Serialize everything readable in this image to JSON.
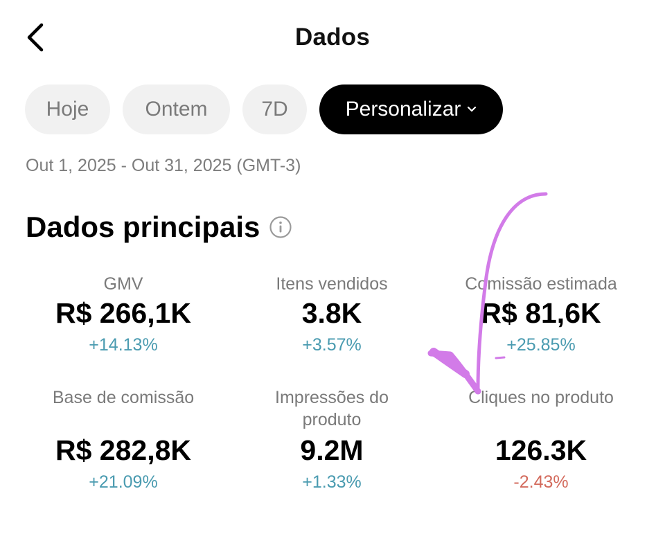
{
  "header": {
    "title": "Dados"
  },
  "filters": {
    "chips": [
      "Hoje",
      "Ontem",
      "7D"
    ],
    "custom_label": "Personalizar"
  },
  "date_range": "Out 1, 2025 - Out 31, 2025 (GMT-3)",
  "section": {
    "title": "Dados principais"
  },
  "metrics": [
    {
      "label": "GMV",
      "value": "R$ 266,1K",
      "delta": "+14.13%",
      "trend": "up"
    },
    {
      "label": "Itens vendidos",
      "value": "3.8K",
      "delta": "+3.57%",
      "trend": "up"
    },
    {
      "label": "Comissão estimada",
      "value": "R$ 81,6K",
      "delta": "+25.85%",
      "trend": "up"
    },
    {
      "label": "Base de comissão",
      "value": "R$ 282,8K",
      "delta": "+21.09%",
      "trend": "up"
    },
    {
      "label": "Impressões do produto",
      "value": "9.2M",
      "delta": "+1.33%",
      "trend": "up"
    },
    {
      "label": "Cliques no produto",
      "value": "126.3K",
      "delta": "-2.43%",
      "trend": "down"
    }
  ],
  "colors": {
    "positive": "#4a9bb0",
    "negative": "#d36a5c",
    "annotation": "#d27be8"
  },
  "icons": {
    "back": "chevron-left-icon",
    "dropdown": "chevron-down-icon",
    "info": "info-circle-icon"
  }
}
